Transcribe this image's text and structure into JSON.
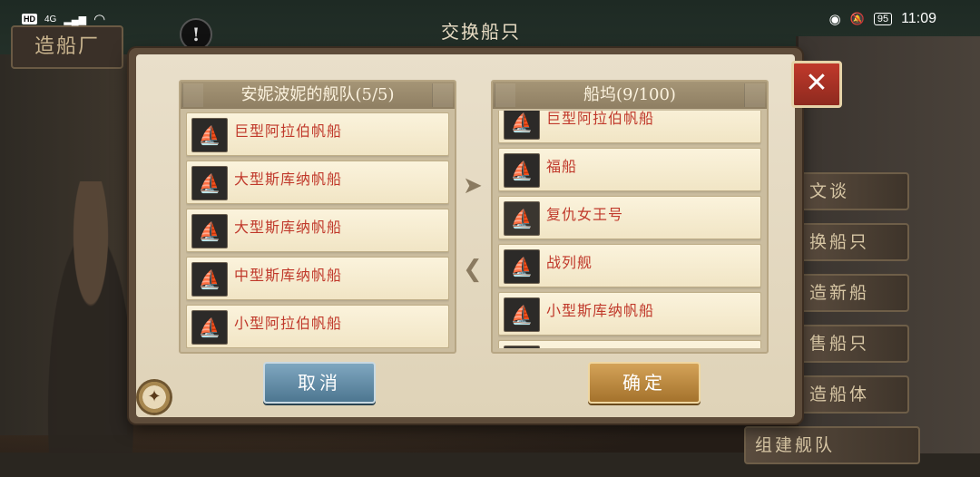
{
  "status_bar": {
    "hd": "HD",
    "network": "4G",
    "signal_glyph": "▂▄▆",
    "wifi_glyph": "◠",
    "eye_glyph": "◉",
    "bell_off_glyph": "🔕",
    "battery": "95",
    "time": "11:09"
  },
  "background": {
    "top_sign": "造船厂",
    "alert_glyph": "!"
  },
  "dialog": {
    "title": "交换船只",
    "close_glyph": "✕",
    "left_panel": {
      "title": "安妮波妮的舰队(5/5)",
      "ships": [
        {
          "name": "巨型阿拉伯帆船",
          "icon": "ship-icon"
        },
        {
          "name": "大型斯库纳帆船",
          "icon": "ship-icon"
        },
        {
          "name": "大型斯库纳帆船",
          "icon": "ship-icon"
        },
        {
          "name": "中型斯库纳帆船",
          "icon": "ship-icon"
        },
        {
          "name": "小型阿拉伯帆船",
          "icon": "ship-icon"
        }
      ]
    },
    "right_panel": {
      "title": "船坞(9/100)",
      "ships": [
        {
          "name": "巨型阿拉伯帆船",
          "icon": "ship-icon"
        },
        {
          "name": "福船",
          "icon": "ship-icon"
        },
        {
          "name": "复仇女王号",
          "icon": "ship-icon"
        },
        {
          "name": "战列舰",
          "icon": "ship-icon"
        },
        {
          "name": "小型斯库纳帆船",
          "icon": "ship-icon"
        },
        {
          "name": "",
          "icon": "ship-icon"
        }
      ]
    },
    "arrow_right_glyph": "➤",
    "arrow_left_glyph": "❮",
    "cancel_label": "取消",
    "confirm_label": "确定"
  },
  "side_menu": [
    {
      "label": "文谈"
    },
    {
      "label": "换船只"
    },
    {
      "label": "造新船"
    },
    {
      "label": "售船只"
    },
    {
      "label": "造船体"
    },
    {
      "label": "组建舰队"
    }
  ],
  "ship_glyph": "⛵",
  "compass_glyph": "✦",
  "colors": {
    "ship_name": "#c0392b",
    "close_button": "#c0392b",
    "cancel_button": "#5b86a1",
    "confirm_button": "#c08a3e"
  }
}
